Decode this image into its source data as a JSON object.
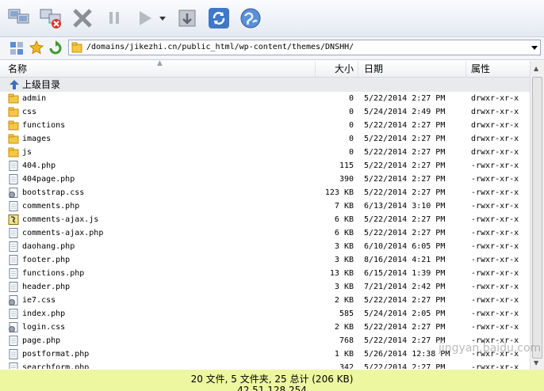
{
  "toolbar": {
    "buttons": [
      {
        "name": "connect-icon"
      },
      {
        "name": "disconnect-icon"
      },
      {
        "name": "cancel-icon"
      },
      {
        "name": "pause-icon"
      },
      {
        "name": "play-icon"
      },
      {
        "name": "play-dropdown-icon"
      },
      {
        "name": "transfer-queue-icon"
      },
      {
        "name": "refresh-icon"
      },
      {
        "name": "globe-icon"
      }
    ]
  },
  "path": {
    "value": "/domains/jikezhi.cn/public_html/wp-content/themes/DNSHH/"
  },
  "columns": {
    "name": "名称",
    "size": "大小",
    "date": "日期",
    "perm": "属性"
  },
  "parent_dir": "上级目录",
  "files": [
    {
      "name": "admin",
      "size": "0",
      "date": "5/22/2014 2:27 PM",
      "perm": "drwxr-xr-x",
      "type": "folder"
    },
    {
      "name": "css",
      "size": "0",
      "date": "5/24/2014 2:49 PM",
      "perm": "drwxr-xr-x",
      "type": "folder"
    },
    {
      "name": "functions",
      "size": "0",
      "date": "5/22/2014 2:27 PM",
      "perm": "drwxr-xr-x",
      "type": "folder"
    },
    {
      "name": "images",
      "size": "0",
      "date": "5/22/2014 2:27 PM",
      "perm": "drwxr-xr-x",
      "type": "folder"
    },
    {
      "name": "js",
      "size": "0",
      "date": "5/22/2014 2:27 PM",
      "perm": "drwxr-xr-x",
      "type": "folder"
    },
    {
      "name": "404.php",
      "size": "115",
      "date": "5/22/2014 2:27 PM",
      "perm": "-rwxr-xr-x",
      "type": "doc"
    },
    {
      "name": "404page.php",
      "size": "390",
      "date": "5/22/2014 2:27 PM",
      "perm": "-rwxr-xr-x",
      "type": "doc"
    },
    {
      "name": "bootstrap.css",
      "size": "123 KB",
      "date": "5/22/2014 2:27 PM",
      "perm": "-rwxr-xr-x",
      "type": "css"
    },
    {
      "name": "comments.php",
      "size": "7 KB",
      "date": "6/13/2014 3:10 PM",
      "perm": "-rwxr-xr-x",
      "type": "doc"
    },
    {
      "name": "comments-ajax.js",
      "size": "6 KB",
      "date": "5/22/2014 2:27 PM",
      "perm": "-rwxr-xr-x",
      "type": "js"
    },
    {
      "name": "comments-ajax.php",
      "size": "6 KB",
      "date": "5/22/2014 2:27 PM",
      "perm": "-rwxr-xr-x",
      "type": "doc"
    },
    {
      "name": "daohang.php",
      "size": "3 KB",
      "date": "6/10/2014 6:05 PM",
      "perm": "-rwxr-xr-x",
      "type": "doc"
    },
    {
      "name": "footer.php",
      "size": "3 KB",
      "date": "8/16/2014 4:21 PM",
      "perm": "-rwxr-xr-x",
      "type": "doc"
    },
    {
      "name": "functions.php",
      "size": "13 KB",
      "date": "6/15/2014 1:39 PM",
      "perm": "-rwxr-xr-x",
      "type": "doc"
    },
    {
      "name": "header.php",
      "size": "3 KB",
      "date": "7/21/2014 2:42 PM",
      "perm": "-rwxr-xr-x",
      "type": "doc"
    },
    {
      "name": "ie7.css",
      "size": "2 KB",
      "date": "5/22/2014 2:27 PM",
      "perm": "-rwxr-xr-x",
      "type": "css"
    },
    {
      "name": "index.php",
      "size": "585",
      "date": "5/24/2014 2:05 PM",
      "perm": "-rwxr-xr-x",
      "type": "doc"
    },
    {
      "name": "login.css",
      "size": "2 KB",
      "date": "5/22/2014 2:27 PM",
      "perm": "-rwxr-xr-x",
      "type": "css"
    },
    {
      "name": "page.php",
      "size": "768",
      "date": "5/22/2014 2:27 PM",
      "perm": "-rwxr-xr-x",
      "type": "doc"
    },
    {
      "name": "postformat.php",
      "size": "1 KB",
      "date": "5/26/2014 12:38 PM",
      "perm": "-rwxr-xr-x",
      "type": "doc"
    },
    {
      "name": "searchform.php",
      "size": "342",
      "date": "5/22/2014 2:27 PM",
      "perm": "-rwxr-xr-x",
      "type": "doc"
    }
  ],
  "status": {
    "summary": "20 文件, 5 文件夹, 25 总计 (206 KB)",
    "ip": "42.51.128.254"
  },
  "watermark": "jingyan.baidu.com"
}
